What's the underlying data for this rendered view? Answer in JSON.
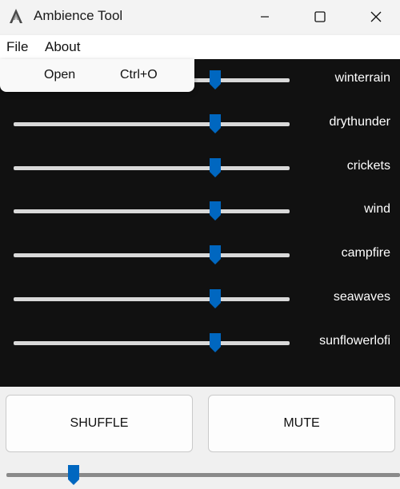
{
  "window": {
    "title": "Ambience Tool",
    "icon": "app-logo-icon",
    "controls": [
      "minimize-icon",
      "maximize-icon",
      "close-icon"
    ]
  },
  "menubar": {
    "file": "File",
    "about": "About"
  },
  "file_menu": {
    "items": [
      {
        "label": "Open",
        "shortcut": "Ctrl+O"
      }
    ]
  },
  "channels": [
    {
      "name": "winterrain",
      "level": 0.73
    },
    {
      "name": "drythunder",
      "level": 0.73
    },
    {
      "name": "crickets",
      "level": 0.73
    },
    {
      "name": "wind",
      "level": 0.73
    },
    {
      "name": "campfire",
      "level": 0.73
    },
    {
      "name": "seawaves",
      "level": 0.73
    },
    {
      "name": "sunflowerlofi",
      "level": 0.73
    }
  ],
  "buttons": {
    "shuffle": "SHUFFLE",
    "mute": "MUTE"
  },
  "master_volume": {
    "level": 0.17
  },
  "colors": {
    "accent": "#0067c0",
    "mixer_background": "#111111",
    "track": "#d9d9d9",
    "label_text": "#ffffff"
  }
}
